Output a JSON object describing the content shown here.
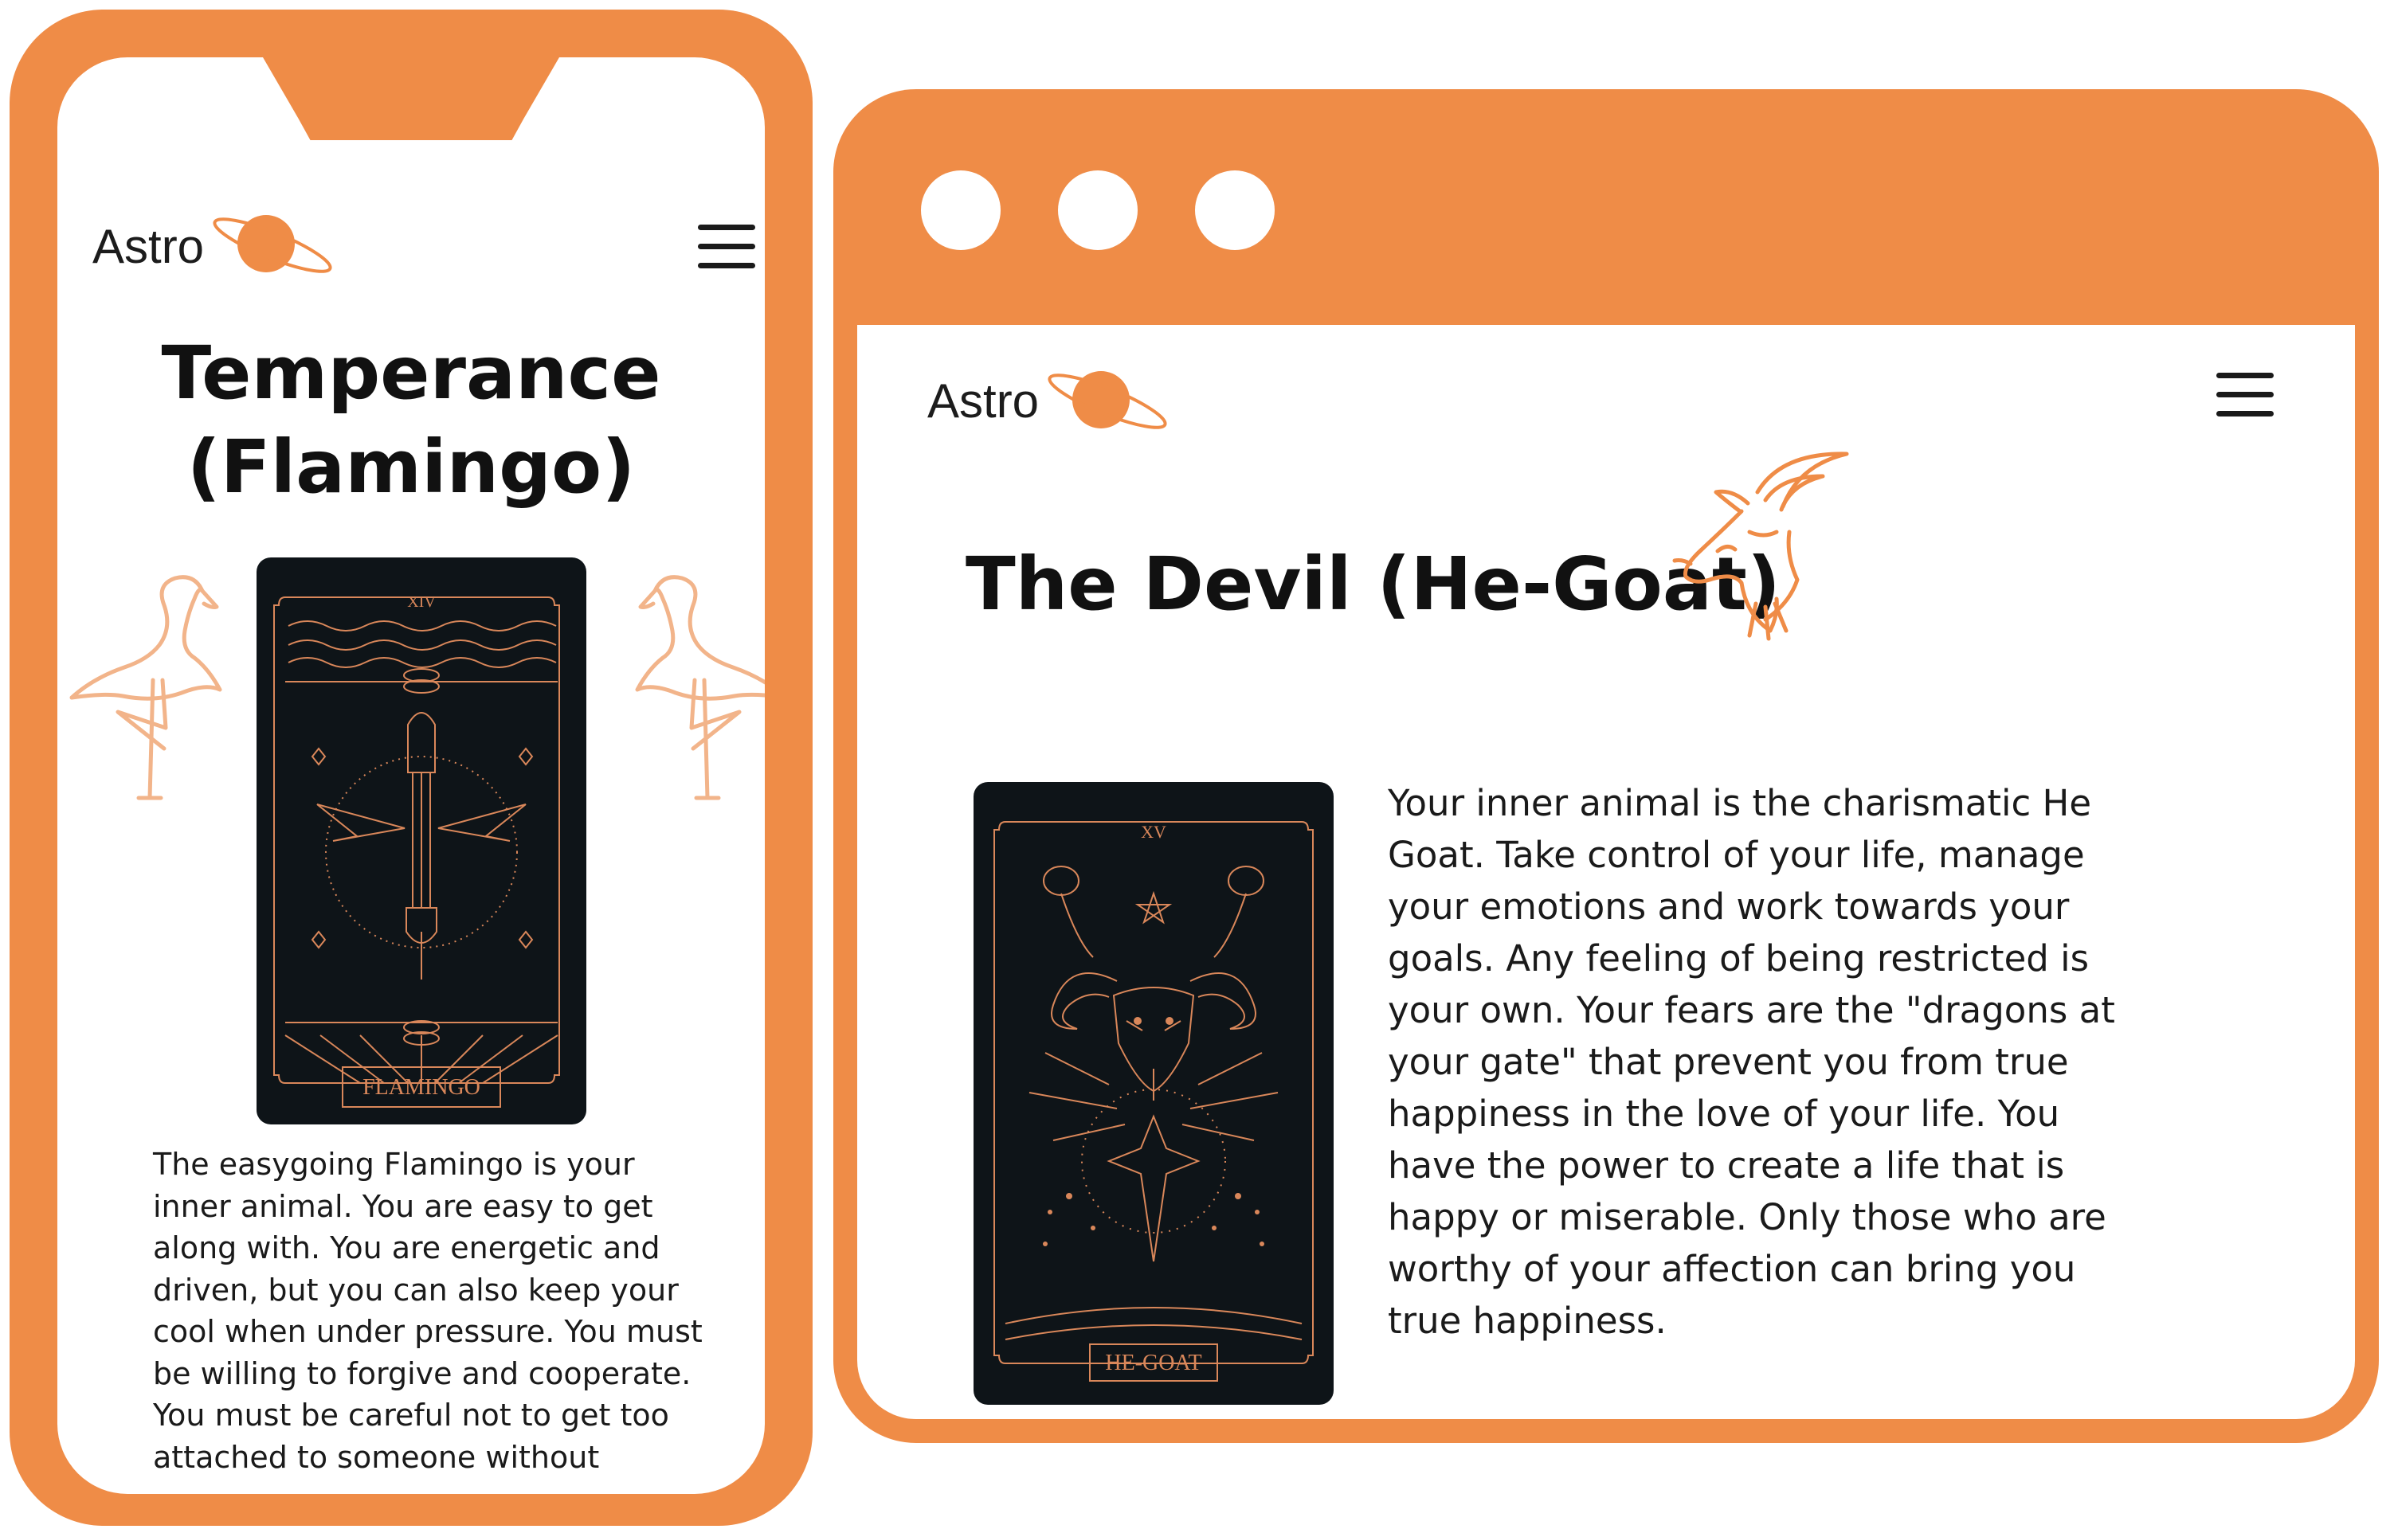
{
  "colors": {
    "accent": "#ef8c47",
    "card_bg": "#0e1418",
    "card_line": "#d9875a",
    "flamingo_line": "#f2b48a",
    "text": "#1a1a1a"
  },
  "phone": {
    "logo_text": "Astro",
    "menu_icon": "hamburger-icon",
    "title_line1": "Temperance",
    "title_line2": "(Flamingo)",
    "card": {
      "numeral": "XIV",
      "name": "FLAMINGO"
    },
    "description": "The easygoing Flamingo is your inner animal. You are easy to get along with. You are energetic and driven, but you can also keep your cool when under pressure. You must be willing to forgive and cooperate. You must be careful not to get too attached to someone without"
  },
  "browser": {
    "window_dots": [
      "dot-1",
      "dot-2",
      "dot-3"
    ],
    "logo_text": "Astro",
    "menu_icon": "hamburger-icon",
    "title": "The Devil (He-Goat)",
    "card": {
      "numeral": "XV",
      "name": "HE-GOAT"
    },
    "description": "Your inner animal is the charismatic He Goat. Take control of your life, manage your emotions and work towards your goals. Any feeling of being restricted is your own. Your fears are the \"dragons at your gate\" that prevent you from true happiness in the love of your life. You have the power to create a life that is happy or miserable. Only those who are worthy of your affection can bring you true happiness."
  }
}
